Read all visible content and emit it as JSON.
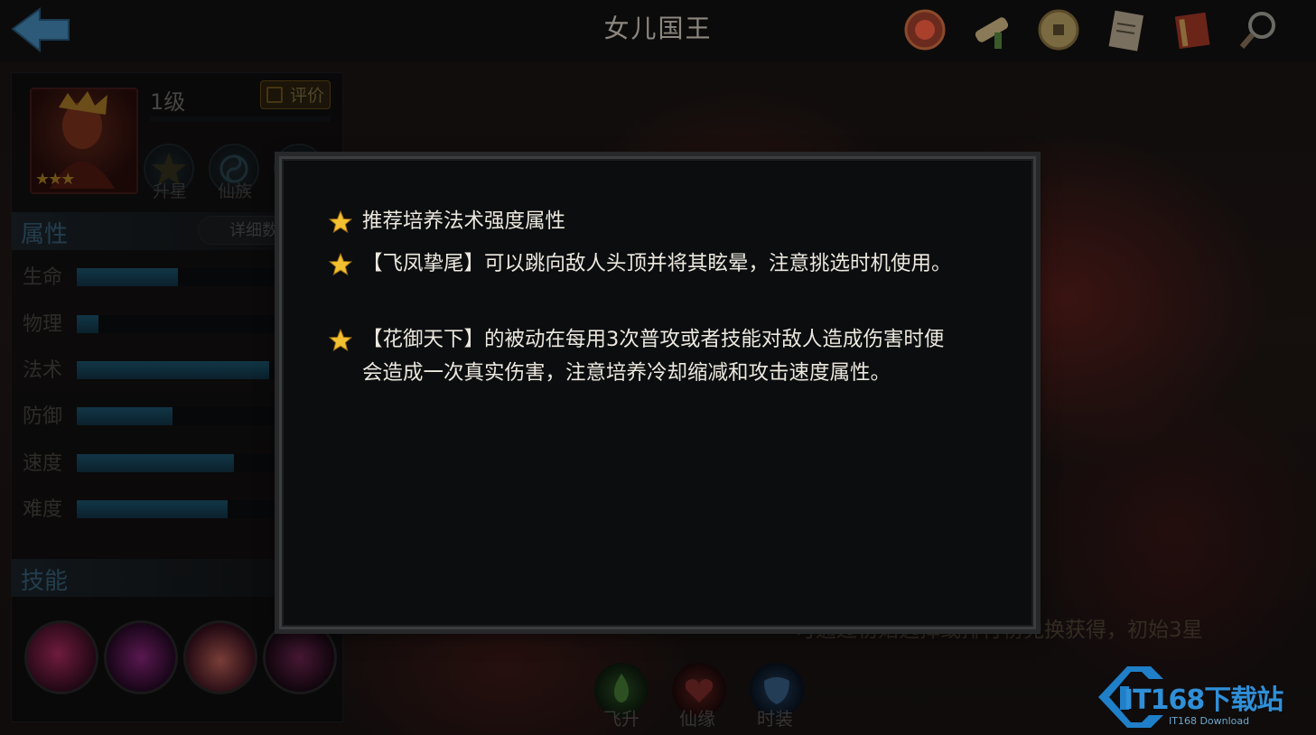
{
  "header": {
    "title": "女儿国王"
  },
  "hero": {
    "level": "1级",
    "rate_label": "评价",
    "stars": "★★★",
    "star_up_label": "升星",
    "clan_label": "仙族"
  },
  "attributes": {
    "heading": "属性",
    "detail_label": "详细数",
    "stats": [
      {
        "label": "生命",
        "value": 0.51
      },
      {
        "label": "物理",
        "value": 0.11
      },
      {
        "label": "法术",
        "value": 0.97
      },
      {
        "label": "防御",
        "value": 0.48
      },
      {
        "label": "速度",
        "value": 0.79
      },
      {
        "label": "难度",
        "value": 0.76
      }
    ]
  },
  "skills": {
    "heading": "技能"
  },
  "bottom": {
    "hint": "可通过初始选择或排行榜兑换获得，初始3星",
    "buttons": [
      "飞升",
      "仙缘",
      "时装"
    ]
  },
  "watermark": {
    "brand": "IT168下载站",
    "sub": "IT168 Download"
  },
  "dialog": {
    "tips": [
      "推荐培养法术强度属性",
      "【飞凤挚尾】可以跳向敌人头顶并将其眩晕，注意挑选时机使用。",
      "【花御天下】的被动在每用3次普攻或者技能对敌人造成伤害时便会造成一次真实伤害，注意培养冷却缩减和攻击速度属性。"
    ]
  },
  "colors": {
    "accent_blue": "#3d6a86",
    "star_gold": "#f2c030",
    "dialog_bg": "#0b0d0f"
  }
}
